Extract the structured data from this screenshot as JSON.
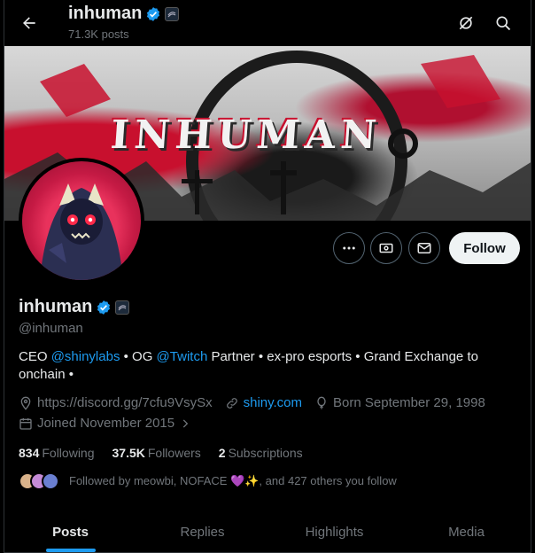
{
  "header": {
    "name": "inhuman",
    "post_count": "71.3K posts"
  },
  "banner": {
    "text": "INHUMAN"
  },
  "profile": {
    "display_name": "inhuman",
    "handle": "@inhuman",
    "bio": {
      "p1": "CEO ",
      "m1": "@shinylabs",
      "p2": " • OG ",
      "m2": "@Twitch",
      "p3": " Partner • ex-pro esports • Grand Exchange to onchain •"
    },
    "website": "https://discord.gg/7cfu9VsySx",
    "link2": "shiny.com",
    "born": "Born September 29, 1998",
    "joined": "Joined November 2015"
  },
  "actions": {
    "follow_label": "Follow"
  },
  "stats": {
    "following_count": "834",
    "following_label": "Following",
    "followers_count": "37.5K",
    "followers_label": "Followers",
    "subs_count": "2",
    "subs_label": "Subscriptions"
  },
  "followed_by": "Followed by meowbi, NOFACE 💜✨, and 427 others you follow",
  "tabs": [
    "Posts",
    "Replies",
    "Highlights",
    "Media"
  ],
  "colors": {
    "accent": "#1d9bf0",
    "verified": "#1d9bf0",
    "banner_red": "#c8102e"
  }
}
